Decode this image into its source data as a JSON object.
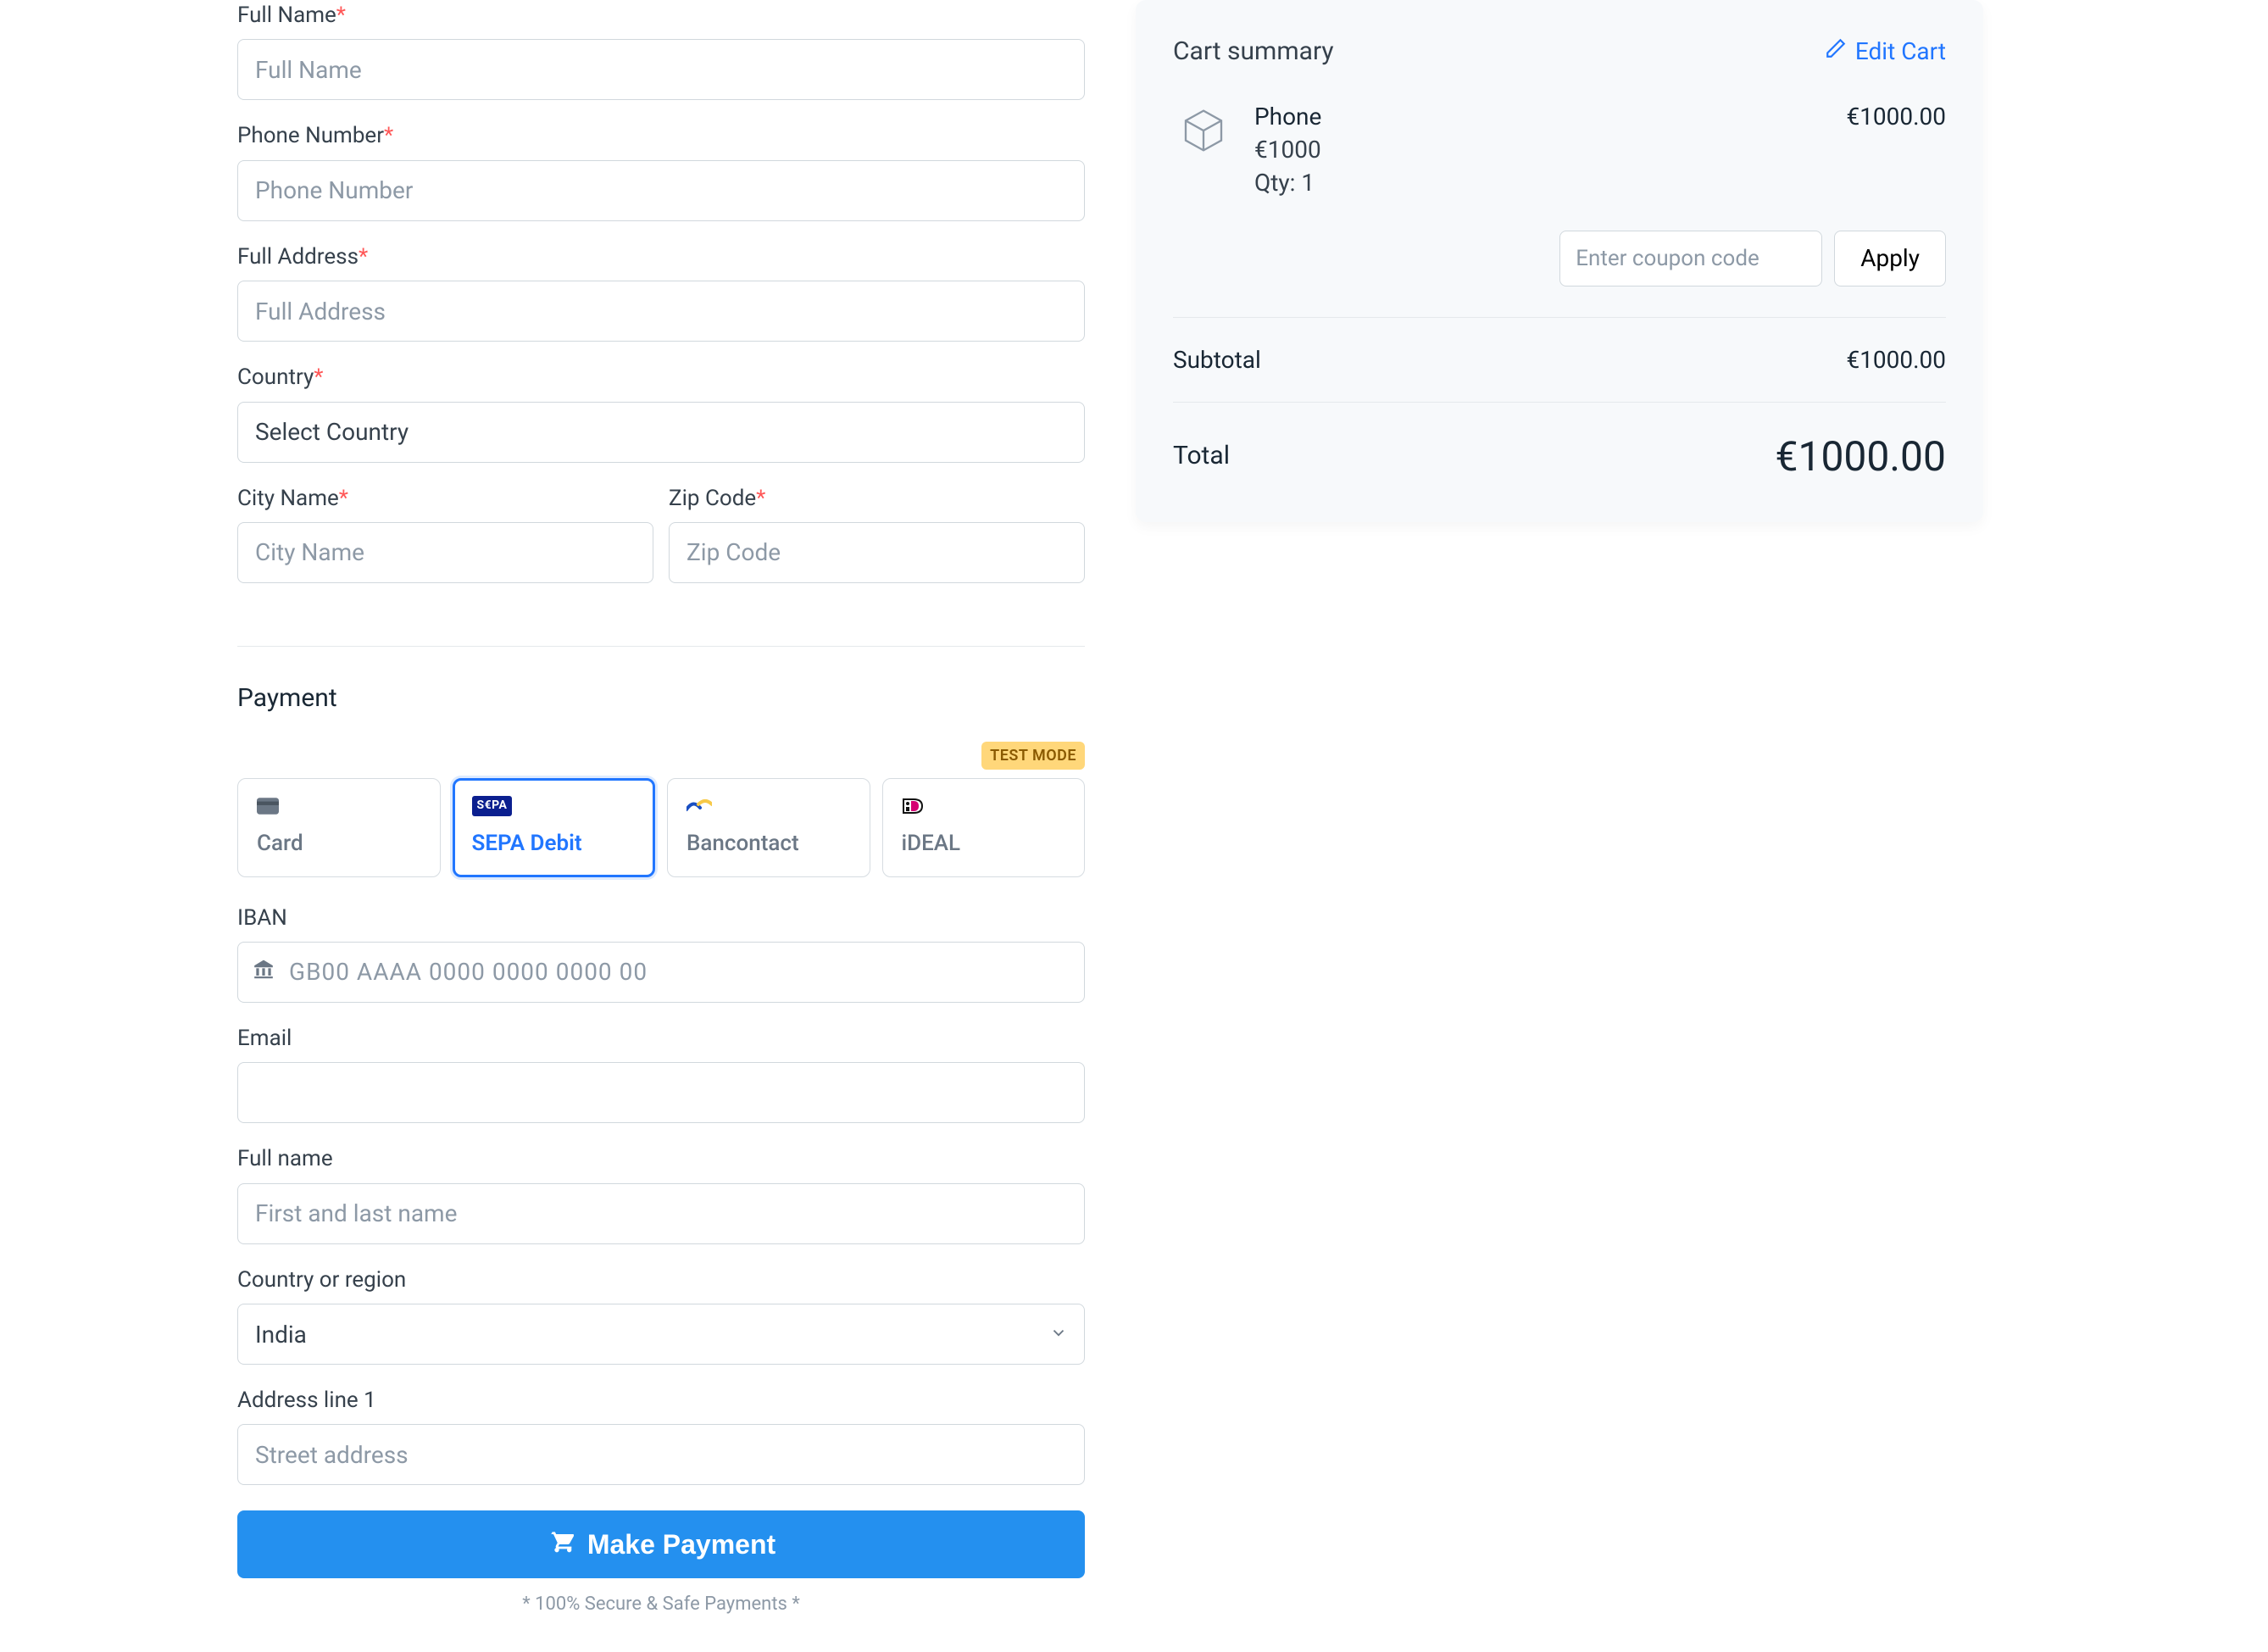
{
  "billing": {
    "full_name": {
      "label": "Full Name",
      "placeholder": "Full Name"
    },
    "phone": {
      "label": "Phone Number",
      "placeholder": "Phone Number"
    },
    "address": {
      "label": "Full Address",
      "placeholder": "Full Address"
    },
    "country": {
      "label": "Country",
      "placeholder": "Select Country"
    },
    "city": {
      "label": "City Name",
      "placeholder": "City Name"
    },
    "zip": {
      "label": "Zip Code",
      "placeholder": "Zip Code"
    }
  },
  "payment": {
    "heading": "Payment",
    "test_mode": "TEST MODE",
    "tabs": {
      "card": "Card",
      "sepa": "SEPA Debit",
      "bancontact": "Bancontact",
      "ideal": "iDEAL"
    },
    "iban": {
      "label": "IBAN",
      "placeholder": "GB00 AAAA 0000 0000 0000 00"
    },
    "email": {
      "label": "Email"
    },
    "full_name": {
      "label": "Full name",
      "placeholder": "First and last name"
    },
    "country_region": {
      "label": "Country or region",
      "value": "India"
    },
    "addr1": {
      "label": "Address line 1",
      "placeholder": "Street address"
    },
    "button": "Make Payment",
    "secure_note": "* 100% Secure & Safe Payments *"
  },
  "cart": {
    "title": "Cart summary",
    "edit_label": "Edit Cart",
    "item": {
      "name": "Phone",
      "price_each": "€1000",
      "qty_label": "Qty: 1",
      "line_total": "€1000.00"
    },
    "coupon_placeholder": "Enter coupon code",
    "apply_label": "Apply",
    "subtotal_label": "Subtotal",
    "subtotal_value": "€1000.00",
    "total_label": "Total",
    "total_value": "€1000.00"
  }
}
